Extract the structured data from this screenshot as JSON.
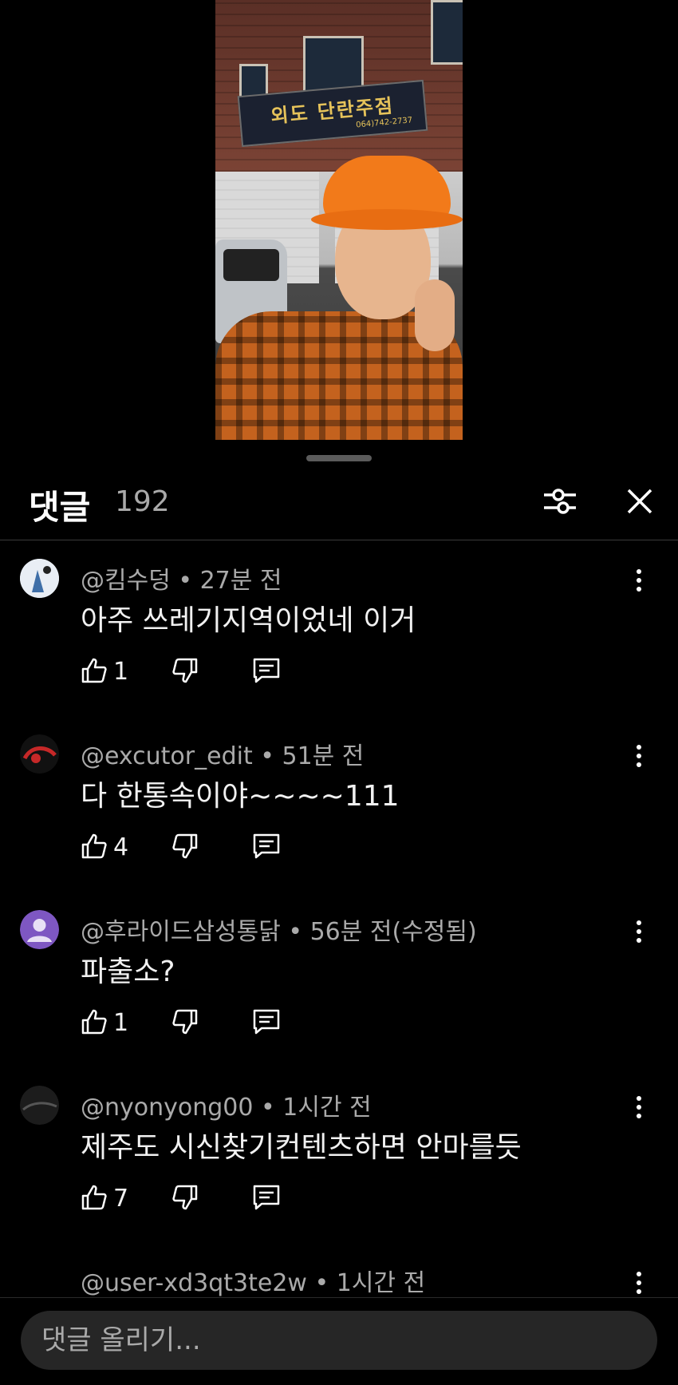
{
  "video": {
    "sign_main": "외도 단란주점",
    "sign_phone": "064)742-2737"
  },
  "header": {
    "title": "댓글",
    "count": "192"
  },
  "comments": [
    {
      "author": "@킴수덩",
      "time": "27분 전",
      "text": "아주 쓰레기지역이었네 이거",
      "likes": "1",
      "avatar_color": "#e9eef5"
    },
    {
      "author": "@excutor_edit",
      "time": "51분 전",
      "text": "다 한통속이야~~~~111",
      "likes": "4",
      "avatar_color": "#1a1a1a"
    },
    {
      "author": "@후라이드삼성통닭",
      "time": "56분 전(수정됨)",
      "text": "파출소?",
      "likes": "1",
      "avatar_color": "#7e57c2"
    },
    {
      "author": "@nyonyong00",
      "time": "1시간 전",
      "text": "제주도 시신찾기컨텐츠하면 안마를듯",
      "likes": "7",
      "avatar_color": "#1c1c1c"
    },
    {
      "author": "@user-xd3qt3te2w",
      "time": "1시간 전"
    }
  ],
  "composer": {
    "placeholder": "댓글 올리기..."
  },
  "icons": {
    "filter": "sliders-icon",
    "close": "close-icon",
    "more": "more-vert-icon",
    "like": "thumb-up-icon",
    "dislike": "thumb-down-icon",
    "reply": "comment-reply-icon"
  }
}
